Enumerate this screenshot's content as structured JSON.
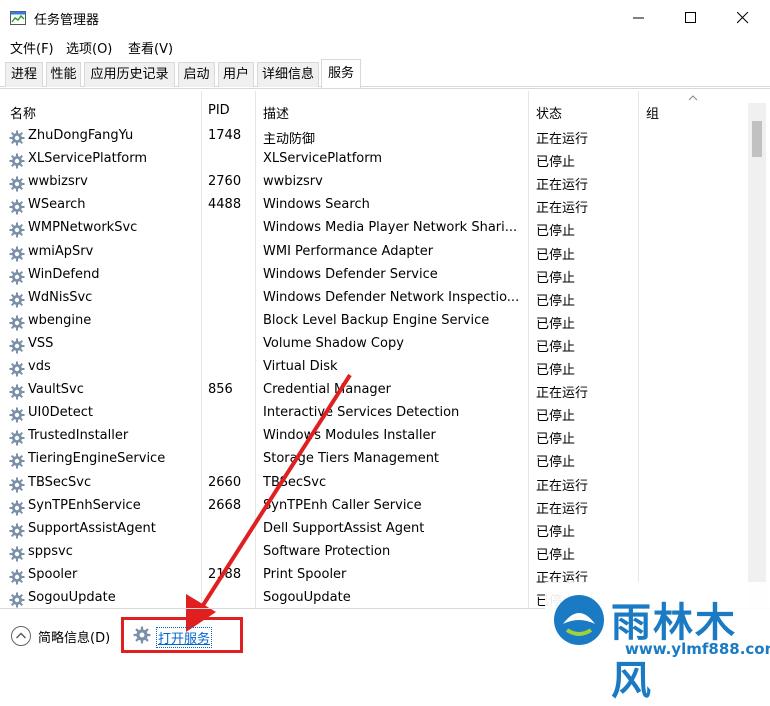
{
  "window": {
    "title": "任务管理器",
    "menu": [
      "文件(F)",
      "选项(O)",
      "查看(V)"
    ]
  },
  "tabs": [
    "进程",
    "性能",
    "应用历史记录",
    "启动",
    "用户",
    "详细信息",
    "服务"
  ],
  "active_tab": "服务",
  "columns": {
    "name": "名称",
    "pid": "PID",
    "desc": "描述",
    "status": "状态",
    "group": "组"
  },
  "rows": [
    {
      "name": "ZhuDongFangYu",
      "pid": "1748",
      "desc": "主动防御",
      "status": "正在运行"
    },
    {
      "name": "XLServicePlatform",
      "pid": "",
      "desc": "XLServicePlatform",
      "status": "已停止"
    },
    {
      "name": "wwbizsrv",
      "pid": "2760",
      "desc": "wwbizsrv",
      "status": "正在运行"
    },
    {
      "name": "WSearch",
      "pid": "4488",
      "desc": "Windows Search",
      "status": "正在运行"
    },
    {
      "name": "WMPNetworkSvc",
      "pid": "",
      "desc": "Windows Media Player Network Shari...",
      "status": "已停止"
    },
    {
      "name": "wmiApSrv",
      "pid": "",
      "desc": "WMI Performance Adapter",
      "status": "已停止"
    },
    {
      "name": "WinDefend",
      "pid": "",
      "desc": "Windows Defender Service",
      "status": "已停止"
    },
    {
      "name": "WdNisSvc",
      "pid": "",
      "desc": "Windows Defender Network Inspectio...",
      "status": "已停止"
    },
    {
      "name": "wbengine",
      "pid": "",
      "desc": "Block Level Backup Engine Service",
      "status": "已停止"
    },
    {
      "name": "VSS",
      "pid": "",
      "desc": "Volume Shadow Copy",
      "status": "已停止"
    },
    {
      "name": "vds",
      "pid": "",
      "desc": "Virtual Disk",
      "status": "已停止"
    },
    {
      "name": "VaultSvc",
      "pid": "856",
      "desc": "Credential Manager",
      "status": "正在运行"
    },
    {
      "name": "UI0Detect",
      "pid": "",
      "desc": "Interactive Services Detection",
      "status": "已停止"
    },
    {
      "name": "TrustedInstaller",
      "pid": "",
      "desc": "Windows Modules Installer",
      "status": "已停止"
    },
    {
      "name": "TieringEngineService",
      "pid": "",
      "desc": "Storage Tiers Management",
      "status": "已停止"
    },
    {
      "name": "TBSecSvc",
      "pid": "2660",
      "desc": "TBSecSvc",
      "status": "正在运行"
    },
    {
      "name": "SynTPEnhService",
      "pid": "2668",
      "desc": "SynTPEnh Caller Service",
      "status": "正在运行"
    },
    {
      "name": "SupportAssistAgent",
      "pid": "",
      "desc": "Dell SupportAssist Agent",
      "status": "已停止"
    },
    {
      "name": "sppsvc",
      "pid": "",
      "desc": "Software Protection",
      "status": "已停止"
    },
    {
      "name": "Spooler",
      "pid": "2188",
      "desc": "Print Spooler",
      "status": "正在运行"
    },
    {
      "name": "SogouUpdate",
      "pid": "",
      "desc": "SogouUpdate",
      "status": "已停止"
    }
  ],
  "footer": {
    "fewer_details": "简略信息(D)",
    "open_services": "打开服务"
  },
  "watermark": {
    "brand": "雨林木风",
    "url": "www.ylmf888.com"
  },
  "colors": {
    "accent": "#1a7bc4",
    "highlight": "#e02020",
    "link": "#0066cc"
  }
}
